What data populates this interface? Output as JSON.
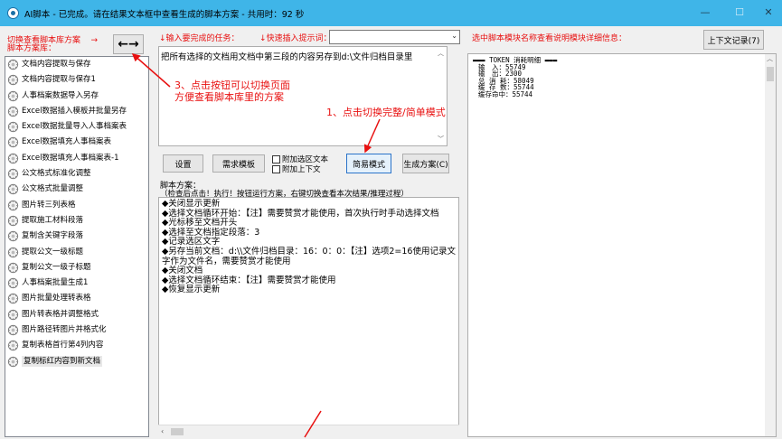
{
  "window": {
    "title": "AI脚本 - 已完成。请在结果文本框中查看生成的脚本方案 - 共用时：92 秒",
    "minimize": "—",
    "maximize": "☐",
    "close": "✕"
  },
  "left_header": {
    "line1": "切换查看脚本库方案",
    "arrow_text": "→",
    "line2": "脚本方案库：",
    "toggle_label": "←→"
  },
  "task_header": {
    "task_label": "↓输入要完成的任务：",
    "quick_label": "↓快速插入提示词：",
    "quick_value": ""
  },
  "right_header": {
    "label": "选中脚本模块名称查看说明模块详细信息：",
    "history_button": "上下文记录(7)"
  },
  "script_library": [
    "文档内容提取与保存",
    "文档内容提取与保存1",
    "人事档案数据导入另存",
    "Excel数据插入模板并批量另存",
    "Excel数据批量导入人事档案表",
    "Excel数据填充人事档案表",
    "Excel数据填充人事档案表-1",
    "公文格式标准化调整",
    "公文格式批量调整",
    "图片转三列表格",
    "提取施工材料段落",
    "复制含关键字段落",
    "提取公文一级标题",
    "复制公文一级子标题",
    "人事档案批量生成1",
    "图片批量处理转表格",
    "图片转表格并调整格式",
    "图片路径转图片并格式化",
    "复制表格首行第4列内容",
    "复制标红内容到新文档"
  ],
  "selected_index": 19,
  "task_input": "把所有选择的文档用文档中第三段的内容另存到d:\\文件归档目录里",
  "buttons": {
    "settings": "设置",
    "demand_template": "需求模板",
    "simple_mode": "简易模式",
    "generate": "生成方案(C)"
  },
  "checkboxes": {
    "append_selection": "附加选区文本",
    "append_context": "附加上下文"
  },
  "plan_header": {
    "line1": "脚本方案：",
    "line2": "（检查后点击！执行！按钮运行方案，右键切换查看本次结果/推理过程）"
  },
  "plan_lines": [
    "◆关闭显示更新",
    "◆选择文档循环开始：【注】需要赞赏才能使用，首次执行时手动选择文档",
    "◆光标移至文档开头",
    "◆选择至文档指定段落：3",
    "◆记录选区文字",
    "◆另存当前文档：d:\\\\文件归档目录：16：0：0：【注】选项2=16使用记录文字作为文件名，需要赞赏才能使用",
    "◆关闭文档",
    "◆选择文档循环结束：【注】需要赞赏才能使用",
    "◆恢复显示更新"
  ],
  "token_info": {
    "header": "TOKEN 消耗明细",
    "rows": [
      "输　入：55749",
      "输　出：2300",
      "总 消 耗：58049",
      "缓 存 数：55744",
      "缓存命中：55744"
    ]
  },
  "annotations": {
    "note3_line1": "3、点击按钮可以切换页面",
    "note3_line2": "方便查看脚本库里的方案",
    "note1": "1、点击切换完整/简单模式"
  },
  "colors": {
    "titlebar": "#3fb5e8",
    "annotation_red": "#e81010",
    "active_border": "#2a73c9"
  }
}
